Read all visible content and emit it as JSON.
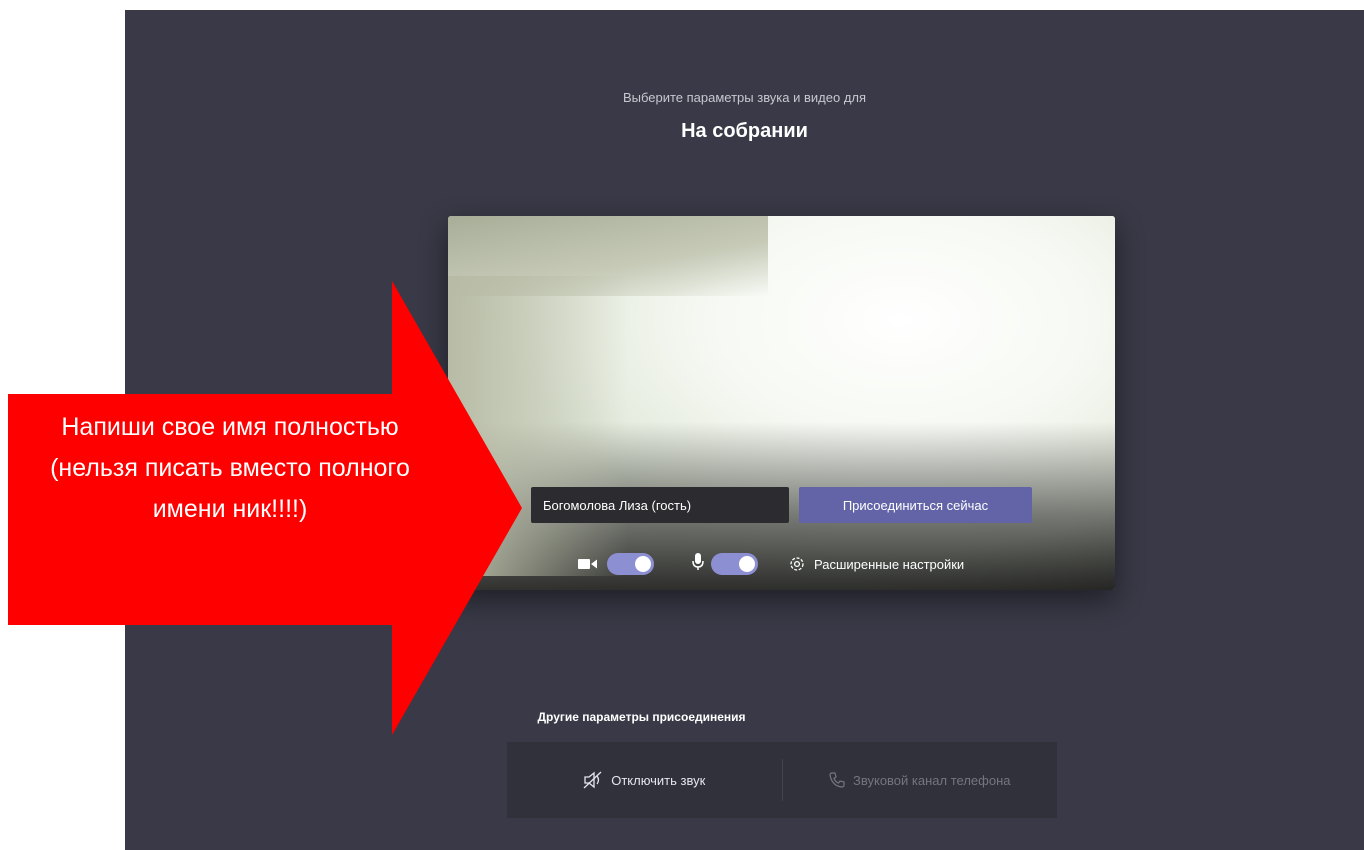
{
  "header": {
    "subtitle": "Выберите параметры звука и видео для",
    "title": "На собрании"
  },
  "preview": {
    "name_value": "Богомолова Лиза (гость)",
    "join_label": "Присоединиться сейчас",
    "camera_on": true,
    "mic_on": true,
    "settings_label": "Расширенные настройки"
  },
  "other": {
    "label": "Другие параметры присоединения",
    "mute_label": "Отключить звук",
    "phone_label": "Звуковой канал телефона"
  },
  "annotation": {
    "text": "Напиши свое имя полностью (нельзя писать вместо полного имени ник!!!!)",
    "color": "#ff0000"
  },
  "colors": {
    "background": "#393947",
    "accent": "#6264a7",
    "toggle": "#8d8fd3"
  }
}
